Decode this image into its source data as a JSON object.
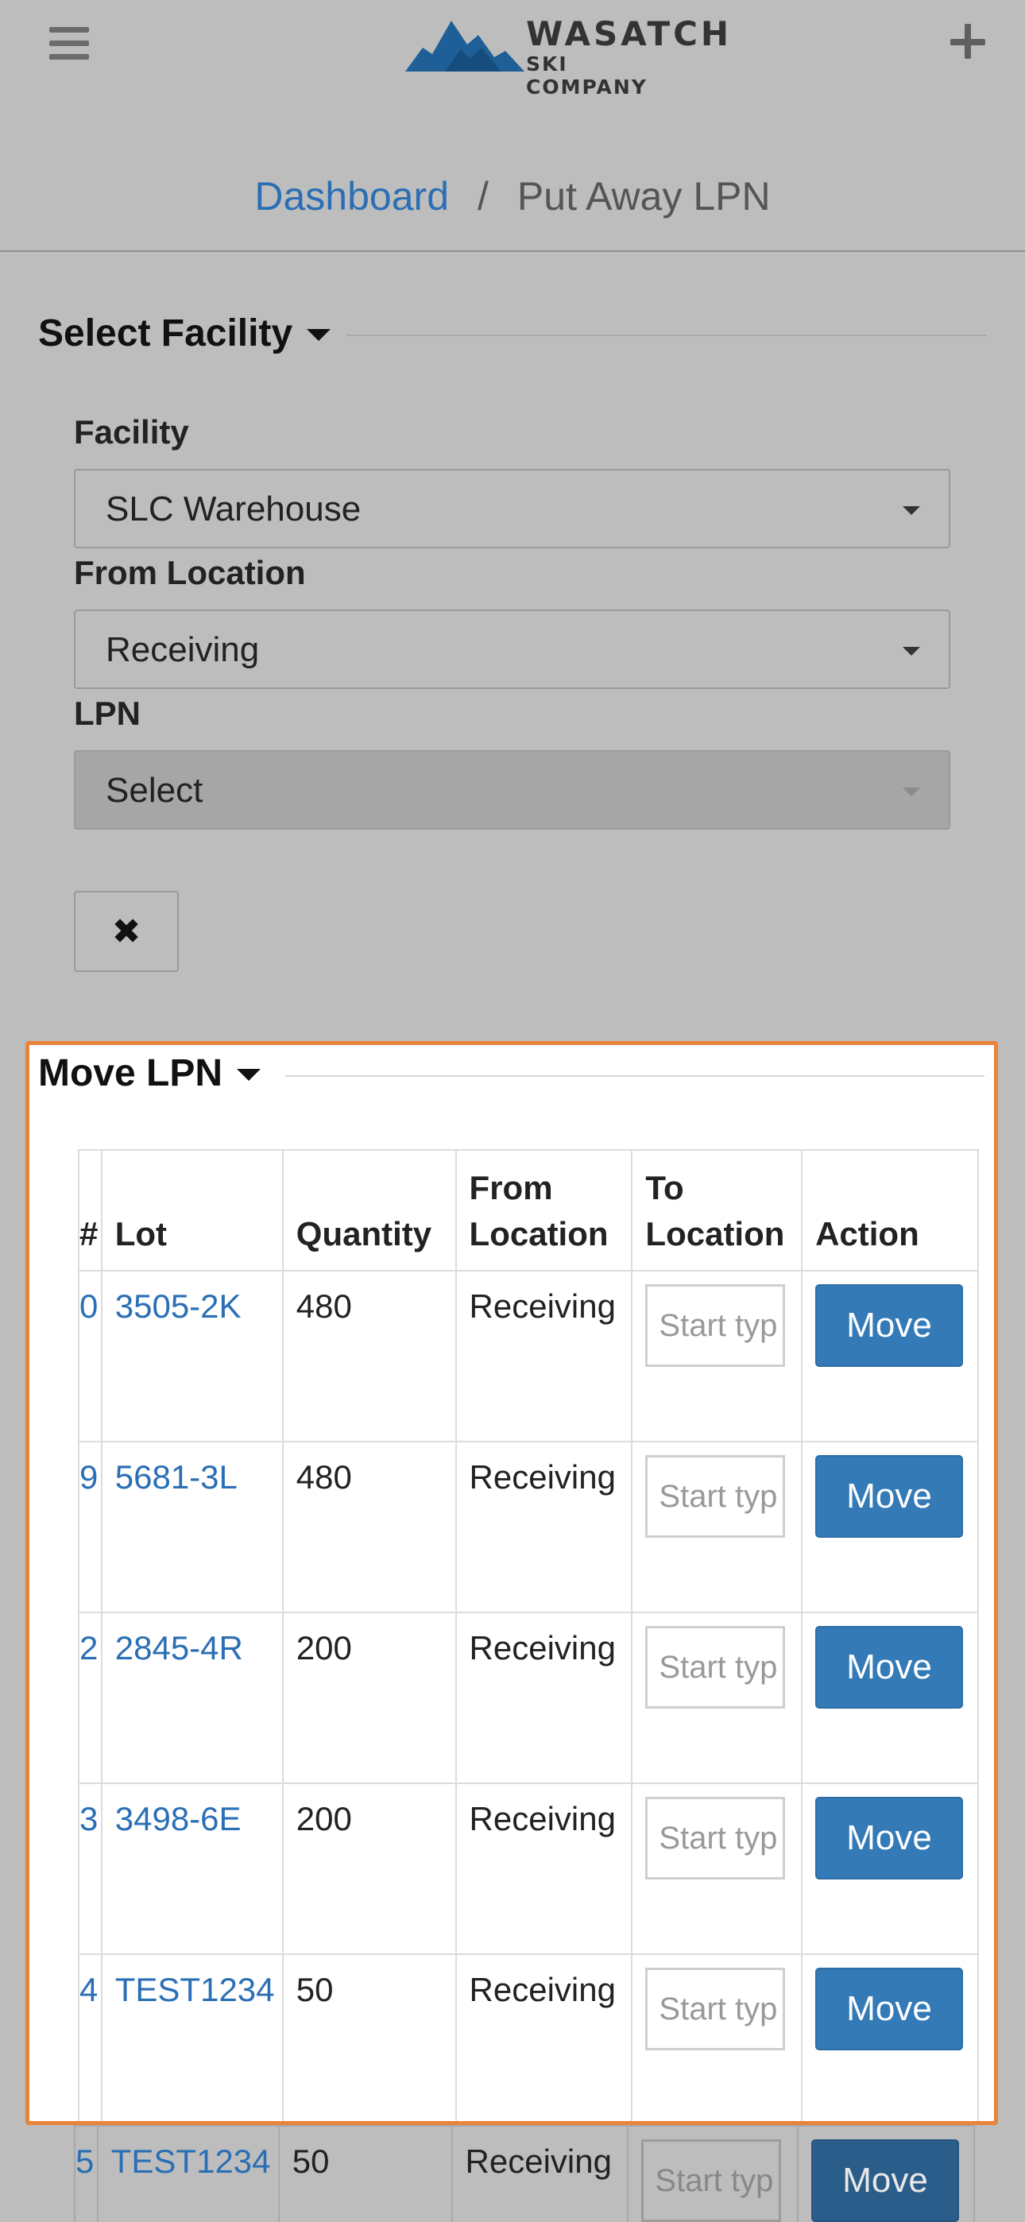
{
  "header": {
    "logo_line1": "WASATCH",
    "logo_line2": "SKI COMPANY",
    "menu_icon": "hamburger-icon",
    "add_icon": "plus-icon"
  },
  "breadcrumb": {
    "home": "Dashboard",
    "separator": "/",
    "current": "Put Away LPN"
  },
  "select_facility": {
    "title": "Select Facility",
    "fields": {
      "facility": {
        "label": "Facility",
        "value": "SLC Warehouse"
      },
      "from_location": {
        "label": "From Location",
        "value": "Receiving"
      },
      "lpn": {
        "label": "LPN",
        "value": "Select",
        "disabled": true
      }
    },
    "clear_label": "✖"
  },
  "move_lpn": {
    "title": "Move LPN",
    "columns": {
      "lpn": "#",
      "lot": "Lot",
      "quantity": "Quantity",
      "from_location": "From Location",
      "to_location": "To Location",
      "action": "Action"
    },
    "rows": [
      {
        "lpn_tail": "0",
        "lot": "3505-2K",
        "quantity": "480",
        "from_location": "Receiving",
        "to_placeholder": "Start typ",
        "action": "Move"
      },
      {
        "lpn_tail": "9",
        "lot": "5681-3L",
        "quantity": "480",
        "from_location": "Receiving",
        "to_placeholder": "Start typ",
        "action": "Move"
      },
      {
        "lpn_tail": "2",
        "lot": "2845-4R",
        "quantity": "200",
        "from_location": "Receiving",
        "to_placeholder": "Start typ",
        "action": "Move"
      },
      {
        "lpn_tail": "3",
        "lot": "3498-6E",
        "quantity": "200",
        "from_location": "Receiving",
        "to_placeholder": "Start typ",
        "action": "Move"
      },
      {
        "lpn_tail": "4",
        "lot": "TEST1234",
        "quantity": "50",
        "from_location": "Receiving",
        "to_placeholder": "Start typ",
        "action": "Move"
      }
    ],
    "overflow_row": {
      "lpn_tail": "5",
      "lot": "TEST1234",
      "quantity": "50",
      "from_location": "Receiving",
      "to_placeholder": "Start typ",
      "action": "Move"
    }
  },
  "colors": {
    "link": "#2a6fb5",
    "primary_button": "#337ab7",
    "highlight_border": "#e8843a",
    "background": "#bdbdbd"
  }
}
